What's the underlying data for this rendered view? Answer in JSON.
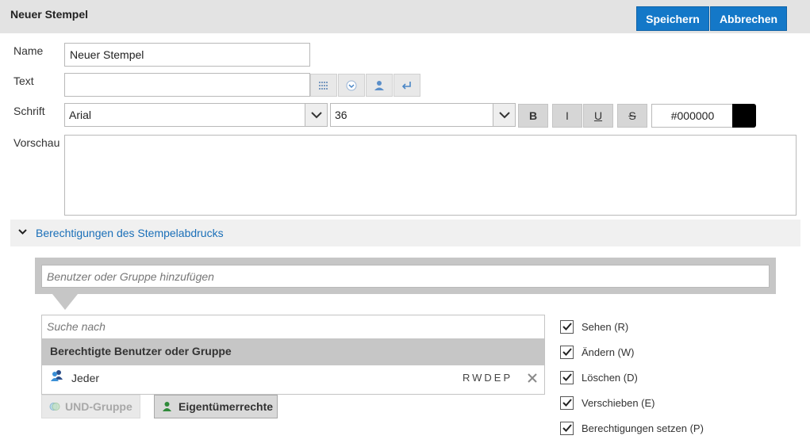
{
  "header": {
    "title": "Neuer Stempel",
    "save_label": "Speichern",
    "cancel_label": "Abbrechen"
  },
  "form": {
    "name_label": "Name",
    "name_value": "Neuer Stempel",
    "text_label": "Text",
    "text_value": "",
    "font_label": "Schrift",
    "font_family": "Arial",
    "font_size": "36",
    "bold_label": "B",
    "italic_label": "I",
    "underline_label": "U",
    "strike_label": "S",
    "color_value": "#000000",
    "preview_label": "Vorschau"
  },
  "permissions": {
    "section_title": "Berechtigungen des Stempelabdrucks",
    "add_placeholder": "Benutzer oder Gruppe hinzufügen",
    "search_placeholder": "Suche nach",
    "list_header": "Berechtigte Benutzer oder Gruppe",
    "rows": [
      {
        "name": "Jeder",
        "perms": "RWDEP"
      }
    ],
    "and_group_label": "UND-Gruppe",
    "owner_rights_label": "Eigentümerrechte",
    "checkboxes": [
      {
        "label": "Sehen (R)",
        "checked": true
      },
      {
        "label": "Ändern (W)",
        "checked": true
      },
      {
        "label": "Löschen (D)",
        "checked": true
      },
      {
        "label": "Verschieben (E)",
        "checked": true
      },
      {
        "label": "Berechtigungen setzen (P)",
        "checked": true
      }
    ]
  },
  "colors": {
    "accent": "#1478c8",
    "link": "#1a6fb8",
    "swatch": "#000000"
  }
}
